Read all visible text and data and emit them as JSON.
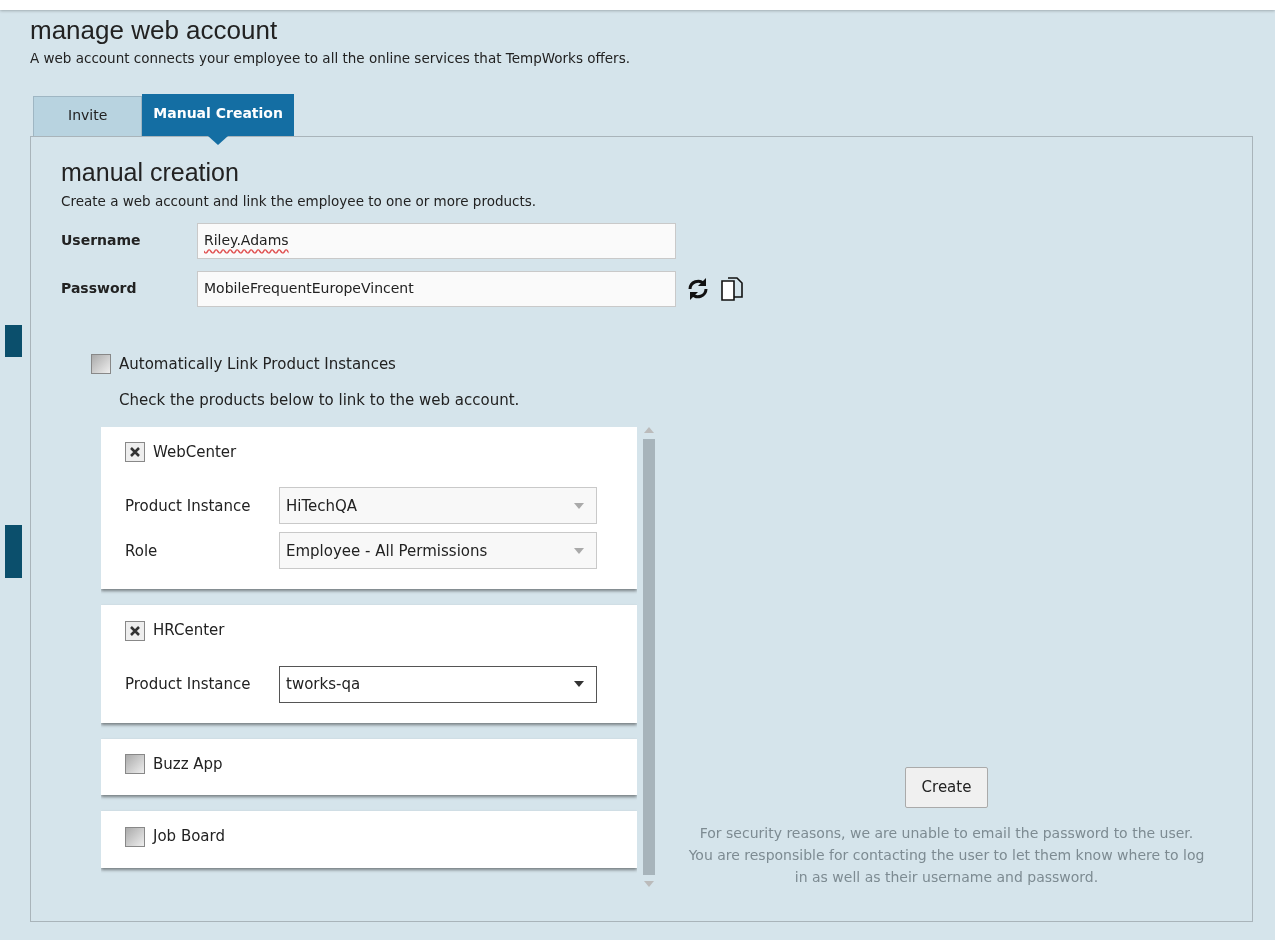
{
  "header": {
    "title": "manage web account",
    "subtitle": "A web account connects your employee to all the online services that TempWorks offers."
  },
  "tabs": [
    {
      "label": "Invite",
      "selected": false
    },
    {
      "label": "Manual Creation",
      "selected": true
    }
  ],
  "panel": {
    "title": "manual creation",
    "subtitle": "Create a web account and link the employee to one or more products.",
    "fields": [
      {
        "label": "Username",
        "value": "Riley.Adams",
        "kind": "text"
      },
      {
        "label": "Password",
        "value": "MobileFrequentEuropeVincent",
        "kind": "password"
      }
    ],
    "auto_link": {
      "label": "Automatically Link Product Instances",
      "checked": false
    },
    "hint": "Check the products below to link to the web account.",
    "products": [
      {
        "name": "WebCenter",
        "checked": true,
        "fields": [
          {
            "label": "Product Instance",
            "value": "HiTechQA",
            "disabled": true
          },
          {
            "label": "Role",
            "value": "Employee - All Permissions",
            "disabled": true
          }
        ]
      },
      {
        "name": "HRCenter",
        "checked": true,
        "fields": [
          {
            "label": "Product Instance",
            "value": "tworks-qa",
            "disabled": false
          }
        ]
      },
      {
        "name": "Buzz App",
        "checked": false
      },
      {
        "name": "Job Board",
        "checked": false
      }
    ],
    "create_button": "Create",
    "note": "For security reasons, we are unable to email the password to the user.  You are responsible for contacting the user to let them know where to log in as well as their username and password."
  }
}
